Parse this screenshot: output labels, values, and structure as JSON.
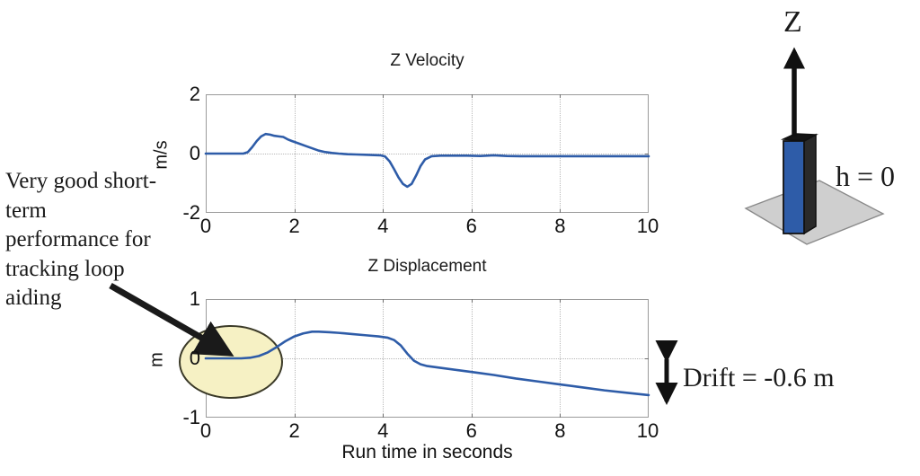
{
  "figure": {
    "background": "#ffffff",
    "annotations": {
      "left_note": "Very good short-term performance for tracking loop aiding",
      "drift_label": "Drift = -0.6 m",
      "h_label": "h = 0",
      "z_axis_label": "Z",
      "highlight_color": "#F6F1C4",
      "curve_color": "#2E5CA8",
      "box_color": "#2E5CA8",
      "ground_color": "#CFCFCF"
    }
  },
  "chart_data": [
    {
      "type": "line",
      "id": "z-velocity",
      "title": "Z Velocity",
      "xlabel": "",
      "ylabel": "m/s",
      "xlim": [
        0,
        10
      ],
      "ylim": [
        -2,
        2
      ],
      "xticks": [
        0,
        2,
        4,
        6,
        8,
        10
      ],
      "yticks": [
        -2,
        0,
        2
      ],
      "xtick_labels": [
        "0",
        "2",
        "4",
        "6",
        "8",
        "10"
      ],
      "ytick_labels": [
        "-2",
        "0",
        "2"
      ],
      "grid": true,
      "legend": null,
      "series": [
        {
          "name": "Z velocity",
          "color": "#2E5CA8",
          "x": [
            0.0,
            0.3,
            0.6,
            0.85,
            0.95,
            1.05,
            1.15,
            1.25,
            1.35,
            1.45,
            1.55,
            1.65,
            1.75,
            1.85,
            1.95,
            2.1,
            2.25,
            2.4,
            2.55,
            2.7,
            2.85,
            3.0,
            3.2,
            3.4,
            3.6,
            3.8,
            3.95,
            4.05,
            4.15,
            4.25,
            4.35,
            4.45,
            4.55,
            4.65,
            4.75,
            4.85,
            4.95,
            5.1,
            5.3,
            5.6,
            5.9,
            6.2,
            6.5,
            6.8,
            7.1,
            7.5,
            8.0,
            8.5,
            9.0,
            9.5,
            10.0
          ],
          "y": [
            0.0,
            0.0,
            0.0,
            0.0,
            0.05,
            0.22,
            0.42,
            0.58,
            0.66,
            0.64,
            0.6,
            0.58,
            0.56,
            0.48,
            0.42,
            0.34,
            0.26,
            0.18,
            0.1,
            0.05,
            0.02,
            0.0,
            -0.02,
            -0.03,
            -0.04,
            -0.05,
            -0.06,
            -0.1,
            -0.26,
            -0.52,
            -0.8,
            -1.02,
            -1.12,
            -1.02,
            -0.74,
            -0.42,
            -0.2,
            -0.09,
            -0.07,
            -0.07,
            -0.07,
            -0.08,
            -0.06,
            -0.08,
            -0.09,
            -0.09,
            -0.09,
            -0.09,
            -0.09,
            -0.09,
            -0.09
          ]
        }
      ]
    },
    {
      "type": "line",
      "id": "z-displacement",
      "title": "Z Displacement",
      "xlabel": "Run time in seconds",
      "ylabel": "m",
      "xlim": [
        0,
        10
      ],
      "ylim": [
        -1,
        1
      ],
      "xticks": [
        0,
        2,
        4,
        6,
        8,
        10
      ],
      "yticks": [
        -1,
        0,
        1
      ],
      "xtick_labels": [
        "0",
        "2",
        "4",
        "6",
        "8",
        "10"
      ],
      "ytick_labels": [
        "-1",
        "0",
        "1"
      ],
      "grid": true,
      "legend": null,
      "series": [
        {
          "name": "Z displacement",
          "color": "#2E5CA8",
          "x": [
            0.0,
            0.4,
            0.8,
            1.0,
            1.2,
            1.4,
            1.6,
            1.8,
            2.0,
            2.2,
            2.4,
            2.55,
            2.8,
            3.0,
            3.3,
            3.6,
            3.9,
            4.1,
            4.25,
            4.4,
            4.55,
            4.7,
            4.85,
            5.0,
            5.3,
            5.7,
            6.1,
            6.5,
            7.0,
            7.5,
            8.0,
            8.5,
            9.0,
            9.5,
            10.0
          ],
          "y": [
            0.0,
            0.0,
            0.0,
            0.01,
            0.04,
            0.1,
            0.19,
            0.29,
            0.37,
            0.42,
            0.45,
            0.45,
            0.44,
            0.43,
            0.41,
            0.39,
            0.37,
            0.35,
            0.31,
            0.22,
            0.08,
            -0.04,
            -0.1,
            -0.13,
            -0.16,
            -0.2,
            -0.24,
            -0.28,
            -0.34,
            -0.39,
            -0.44,
            -0.49,
            -0.54,
            -0.58,
            -0.62
          ]
        }
      ],
      "annotation": {
        "drift_value": -0.6,
        "drift_text": "Drift = -0.6 m"
      }
    }
  ]
}
